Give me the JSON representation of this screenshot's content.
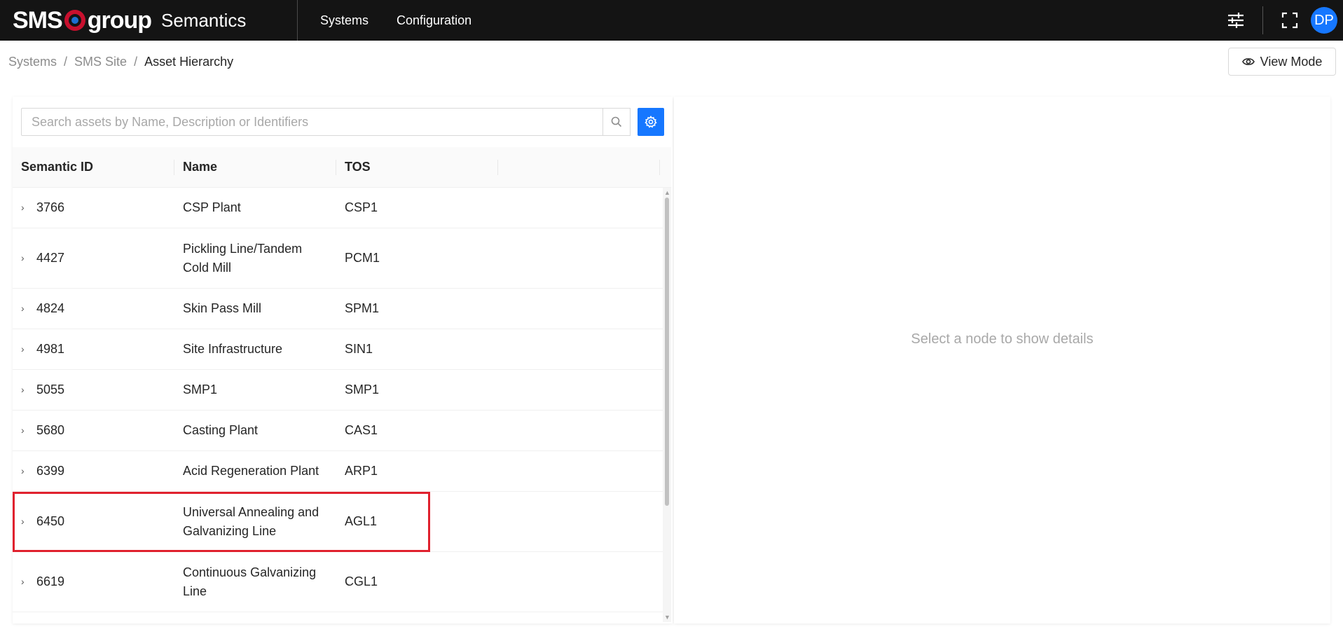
{
  "app": {
    "logo_left": "SMS",
    "logo_right": "group",
    "subtitle": "Semantics"
  },
  "nav": {
    "items": [
      {
        "label": "Systems"
      },
      {
        "label": "Configuration"
      }
    ]
  },
  "user": {
    "initials": "DP",
    "avatar_color": "#1677ff"
  },
  "breadcrumb": {
    "items": [
      "Systems",
      "SMS Site",
      "Asset Hierarchy"
    ],
    "separator": "/"
  },
  "view_mode": {
    "label": "View Mode",
    "icon": "eye-icon"
  },
  "search": {
    "placeholder": "Search assets by Name, Description or Identifiers",
    "value": ""
  },
  "table": {
    "columns": [
      "Semantic ID",
      "Name",
      "TOS"
    ],
    "rows": [
      {
        "id": "3766",
        "name": "CSP Plant",
        "tos": "CSP1"
      },
      {
        "id": "4427",
        "name": "Pickling Line/Tandem Cold Mill",
        "tos": "PCM1"
      },
      {
        "id": "4824",
        "name": "Skin Pass Mill",
        "tos": "SPM1"
      },
      {
        "id": "4981",
        "name": "Site Infrastructure",
        "tos": "SIN1"
      },
      {
        "id": "5055",
        "name": "SMP1",
        "tos": "SMP1"
      },
      {
        "id": "5680",
        "name": "Casting Plant",
        "tos": "CAS1"
      },
      {
        "id": "6399",
        "name": "Acid Regeneration Plant",
        "tos": "ARP1"
      },
      {
        "id": "6450",
        "name": "Universal Annealing and Galvanizing Line",
        "tos": "AGL1",
        "highlighted": true
      },
      {
        "id": "6619",
        "name": "Continuous Galvanizing Line",
        "tos": "CGL1"
      }
    ],
    "highlight_color": "#e0212e"
  },
  "details": {
    "empty_message": "Select a node to show details"
  },
  "colors": {
    "topbar": "#141414",
    "accent": "#1677ff",
    "brand_red": "#c8102e"
  }
}
